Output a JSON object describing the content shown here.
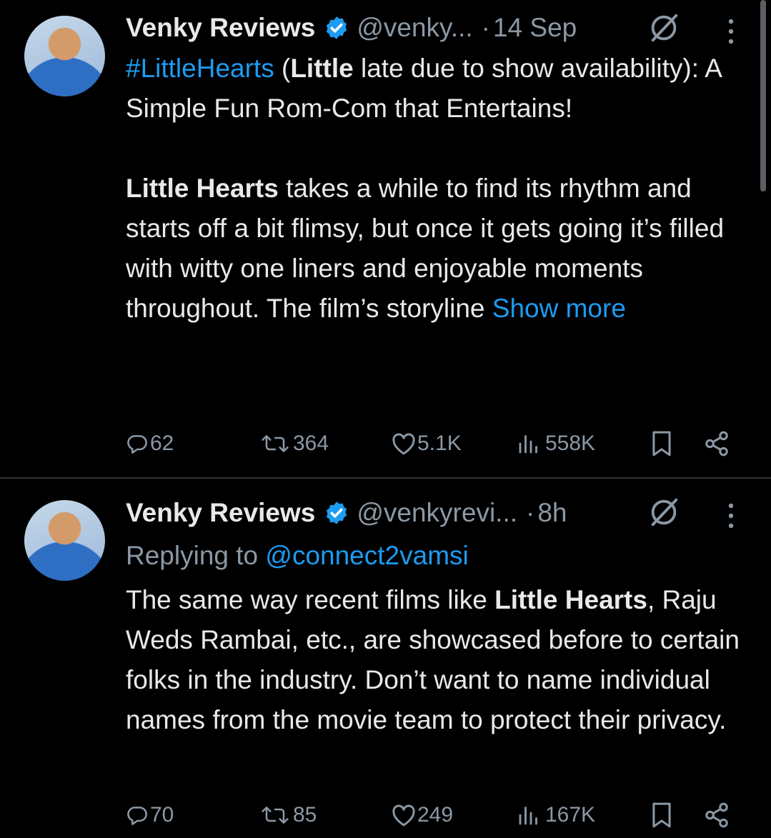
{
  "tweets": [
    {
      "author_name": "Venky Reviews",
      "handle": "@venky...",
      "separator": "·",
      "time": "14 Sep",
      "text": {
        "hashtag": "#LittleHearts",
        "t1": " (",
        "b1": "Little",
        "t2": " late due to show availability): A Simple Fun Rom-Com that Entertains!",
        "b2": "Little Hearts",
        "t3": " takes a while to find its rhythm and starts off a bit flimsy, but once it gets going it’s filled with witty one liners and enjoyable moments throughout. The film’s storyline ",
        "show_more": "Show more"
      },
      "stats": {
        "replies": "62",
        "reposts": "364",
        "likes": "5.1K",
        "views": "558K"
      }
    },
    {
      "author_name": "Venky Reviews",
      "handle": "@venkyrevi...",
      "separator": "·",
      "time": "8h",
      "replying_to_label": "Replying to ",
      "replying_to_handle": "@connect2vamsi",
      "text": {
        "t1": "The same way recent films like ",
        "b1": "Little Hearts",
        "t2": ", Raju Weds Rambai, etc., are showcased before to certain folks in the industry. Don’t want to name individual names from the movie team to protect their privacy."
      },
      "stats": {
        "replies": "70",
        "reposts": "85",
        "likes": "249",
        "views": "167K"
      }
    }
  ],
  "icons": {
    "verified": "verified-badge-icon",
    "grok": "grok-icon",
    "more": "more-options-icon",
    "reply": "reply-icon",
    "repost": "repost-icon",
    "like": "like-icon",
    "views": "views-icon",
    "bookmark": "bookmark-icon",
    "share": "share-icon"
  },
  "colors": {
    "background": "#000000",
    "text": "#e7e9ea",
    "muted": "#8b98a5",
    "link": "#1d9bf0",
    "divider": "#2f3336"
  }
}
